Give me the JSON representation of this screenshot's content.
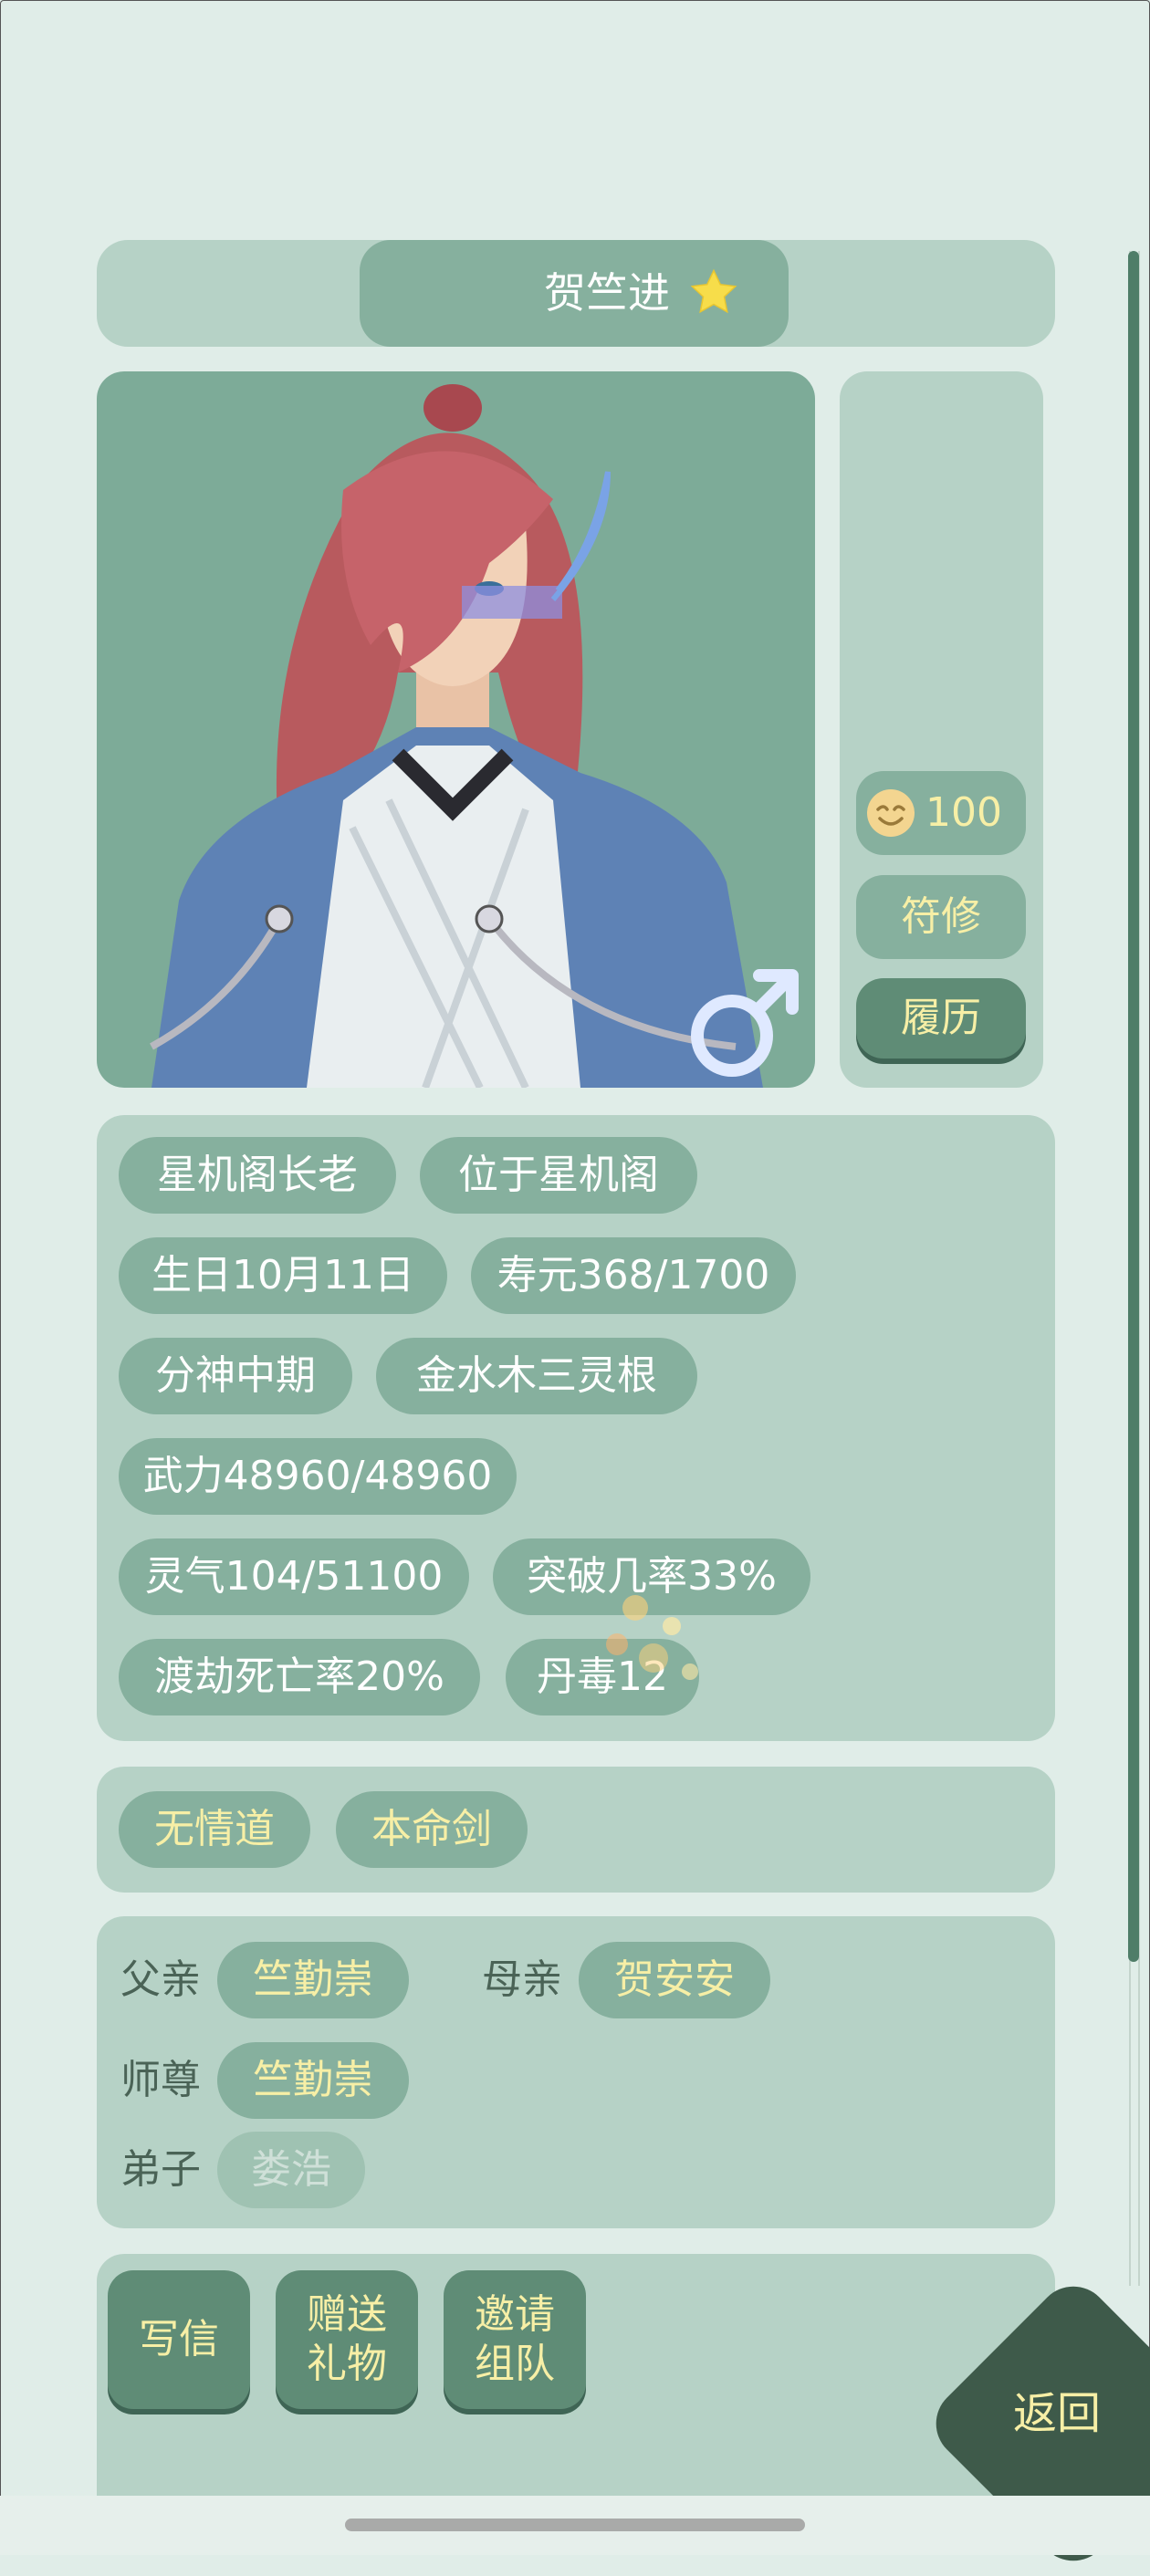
{
  "header": {
    "name": "贺竺进",
    "star_icon": "star-icon"
  },
  "side": {
    "mood_icon": "smiley-face-icon",
    "mood_value": "100",
    "class_label": "符修",
    "history_label": "履历"
  },
  "portrait": {
    "gender_icon": "male-symbol-icon"
  },
  "info_tags": [
    "星机阁长老",
    "位于星机阁",
    "生日10月11日",
    "寿元368/1700",
    "分神中期",
    "金水木三灵根",
    "武力48960/48960",
    "灵气104/51100",
    "突破几率33%",
    "渡劫死亡率20%",
    "丹毒12"
  ],
  "traits": [
    "无情道",
    "本命剑"
  ],
  "relations": {
    "father_label": "父亲",
    "father": "竺勤崇",
    "mother_label": "母亲",
    "mother": "贺安安",
    "master_label": "师尊",
    "master": "竺勤崇",
    "disciple_label": "弟子",
    "disciple": "娄浩"
  },
  "actions": {
    "write_letter": "写信",
    "gift_line1": "赠送",
    "gift_line2": "礼物",
    "invite_line1": "邀请",
    "invite_line2": "组队",
    "back": "返回"
  },
  "colors": {
    "background": "#e0ede8",
    "panel": "#b6d2c6",
    "pill": "#86b09e",
    "button": "#5f8c76",
    "highlight_text": "#f7efa6",
    "back_button": "#3e5a4a"
  }
}
